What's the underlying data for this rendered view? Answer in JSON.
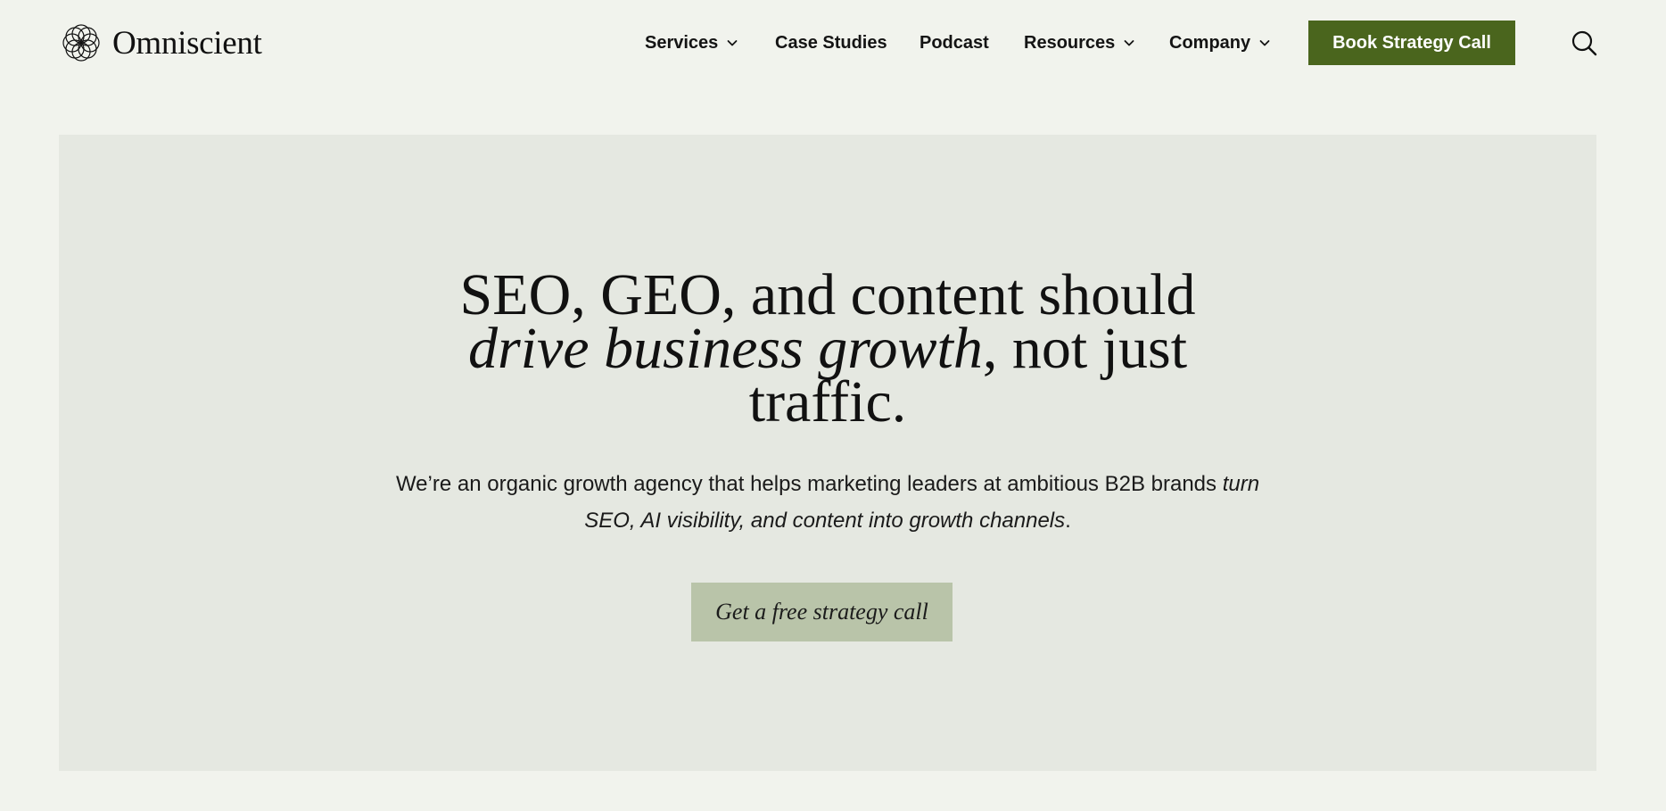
{
  "brand": {
    "name": "Omniscient",
    "logo_icon": "interlaced-rings-logo-icon"
  },
  "nav": {
    "items": [
      {
        "label": "Services",
        "has_dropdown": true
      },
      {
        "label": "Case Studies",
        "has_dropdown": false
      },
      {
        "label": "Podcast",
        "has_dropdown": false
      },
      {
        "label": "Resources",
        "has_dropdown": true
      },
      {
        "label": "Company",
        "has_dropdown": true
      }
    ],
    "cta_label": "Book Strategy Call",
    "search_icon": "search-icon"
  },
  "hero": {
    "title_line1": "SEO, GEO, and content should",
    "title_line2_italic": "drive business growth",
    "title_line2_rest": ", not just",
    "title_line3": "traffic.",
    "subtitle_line1_plain": "We’re an organic growth agency that helps marketing leaders at ambitious B2B brands ",
    "subtitle_line1_italic": "turn",
    "subtitle_line2_italic": "SEO, AI visibility, and content into growth channels",
    "subtitle_line2_end": ".",
    "cta_label": "Get a free strategy call"
  },
  "colors": {
    "page_bg": "#f1f3ed",
    "hero_bg": "#e5e8e1",
    "primary_button": "#4a651d",
    "secondary_button": "#b9c4a9",
    "text": "#111111"
  }
}
